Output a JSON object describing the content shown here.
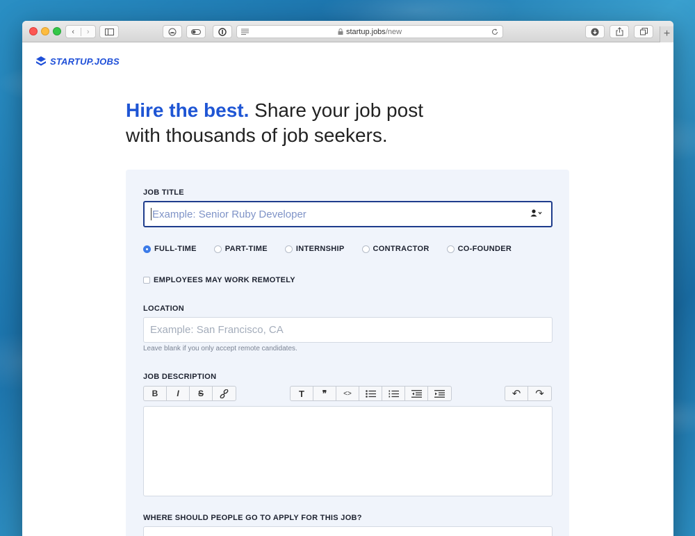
{
  "browser": {
    "url_host": "startup.jobs",
    "url_path": "/new",
    "new_tab_label": "+"
  },
  "site": {
    "logo_text": "STARTUP.JOBS"
  },
  "headline": {
    "accent": "Hire the best.",
    "line1_rest": " Share your job post",
    "line2": "with thousands of job seekers."
  },
  "form": {
    "job_title_label": "JOB TITLE",
    "job_title_placeholder": "Example: Senior Ruby Developer",
    "job_types": [
      {
        "label": "FULL-TIME",
        "selected": true
      },
      {
        "label": "PART-TIME",
        "selected": false
      },
      {
        "label": "INTERNSHIP",
        "selected": false
      },
      {
        "label": "CONTRACTOR",
        "selected": false
      },
      {
        "label": "CO-FOUNDER",
        "selected": false
      }
    ],
    "remote_label": "EMPLOYEES MAY WORK REMOTELY",
    "location_label": "LOCATION",
    "location_placeholder": "Example: San Francisco, CA",
    "location_hint": "Leave blank if you only accept remote candidates.",
    "description_label": "JOB DESCRIPTION",
    "apply_label": "WHERE SHOULD PEOPLE GO TO APPLY FOR THIS JOB?"
  },
  "editor_toolbar": {
    "bold": "B",
    "italic": "I",
    "strike": "S",
    "link": "🔗",
    "heading": "T",
    "quote": "❞",
    "code": "<>",
    "bullets": "☰",
    "numbers": "☷",
    "outdent": "⇤",
    "indent": "⇥",
    "undo": "↶",
    "redo": "↷"
  },
  "colors": {
    "accent": "#1e55d4",
    "radio_selected": "#3c7be8",
    "panel_bg": "#f0f4fb"
  }
}
